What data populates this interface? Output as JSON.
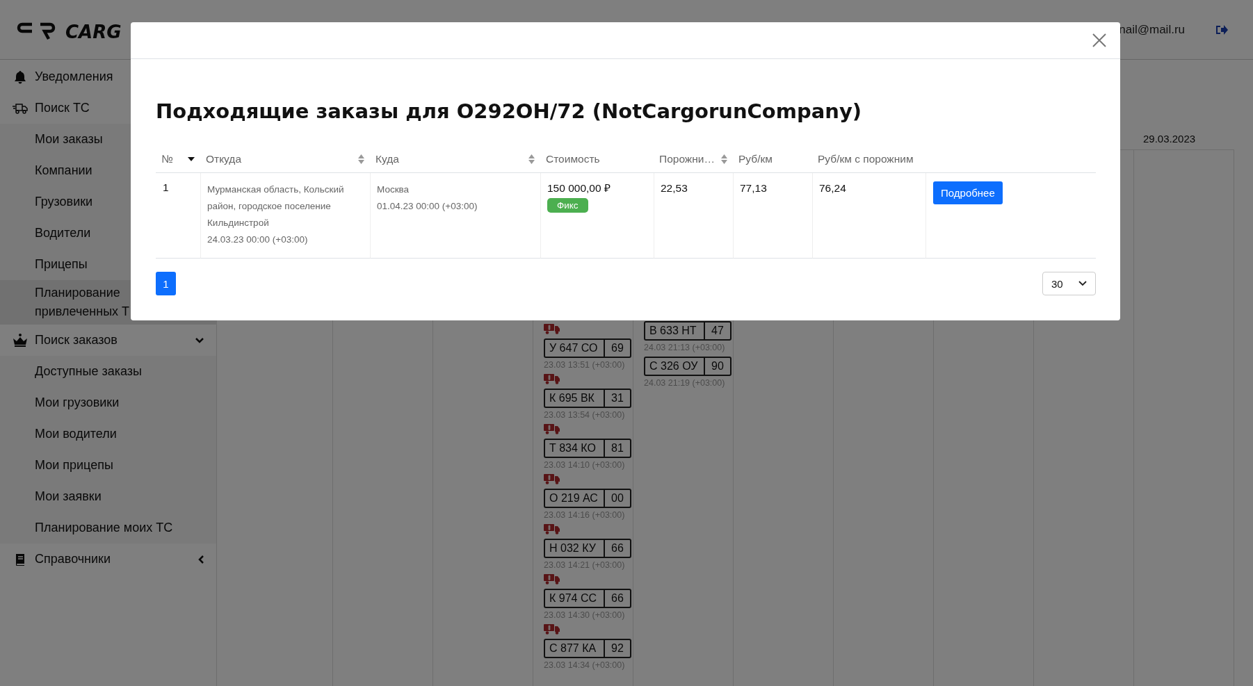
{
  "header": {
    "logo_text": "CARG",
    "user_email": "nail@mail.ru"
  },
  "sidebar": {
    "items": [
      {
        "label": "Уведомления",
        "selected": false
      },
      {
        "label": "Поиск ТС",
        "selected": false,
        "children": [
          {
            "label": "Мои заказы",
            "selected": false
          },
          {
            "label": "Компании",
            "selected": false
          },
          {
            "label": "Грузовики",
            "selected": false
          },
          {
            "label": "Водители",
            "selected": false
          },
          {
            "label": "Прицепы",
            "selected": false
          },
          {
            "label": "Планирование привлеченных Т",
            "selected": true
          }
        ]
      },
      {
        "label": "Поиск заказов",
        "selected": false,
        "expanded": true,
        "children": [
          {
            "label": "Доступные заказы",
            "selected": false
          },
          {
            "label": "Мои грузовики",
            "selected": false
          },
          {
            "label": "Мои водители",
            "selected": false
          },
          {
            "label": "Мои прицепы",
            "selected": false
          },
          {
            "label": "Мои заявки",
            "selected": false
          },
          {
            "label": "Планирование моих ТС",
            "selected": false
          }
        ]
      },
      {
        "label": "Справочники",
        "selected": false,
        "expanded": false
      }
    ]
  },
  "calendar": {
    "visible_date": "29.03.2023",
    "lanes": [
      {
        "entries": [
          {
            "kind": "truck",
            "plate": "У 647 СО",
            "region": "69",
            "time": "23.03 13:51 (+03:00)"
          },
          {
            "kind": "truck",
            "plate": "К 695 ВК",
            "region": "31",
            "time": "23.03 13:54 (+03:00)"
          },
          {
            "kind": "truck",
            "plate": "Т 834 КО",
            "region": "81",
            "time": "23.03 14:10 (+03:00)"
          },
          {
            "kind": "truck",
            "plate": "О 219 АС",
            "region": "00",
            "time": "23.03 14:16 (+03:00)"
          },
          {
            "kind": "truck",
            "plate": "Н 032 КУ",
            "region": "66",
            "time": "23.03 14:21 (+03:00)"
          },
          {
            "kind": "truck",
            "plate": "К 974 СС",
            "region": "66",
            "time": "23.03 14:30 (+03:00)"
          },
          {
            "kind": "truck",
            "plate": "С 877 КА",
            "region": "92",
            "time": "23.03 14:34 (+03:00)"
          }
        ]
      },
      {
        "entries": [
          {
            "kind": "plain",
            "plate": "В 633 НТ",
            "region": "47",
            "time": "24.03 21:13 (+03:00)"
          },
          {
            "kind": "plain",
            "plate": "С 326 ОУ",
            "region": "90",
            "time": "24.03 21:19 (+03:00)"
          }
        ]
      }
    ]
  },
  "modal": {
    "title": "Подходящие заказы для О292ОН/72 (NotCargorunCompany)",
    "columns": [
      {
        "label": "№",
        "sortable": true,
        "sorted": true
      },
      {
        "label": "Откуда",
        "sortable": true,
        "sorted": false
      },
      {
        "label": "Куда",
        "sortable": true,
        "sorted": false
      },
      {
        "label": "Стоимость",
        "sortable": false
      },
      {
        "label": "Порожни…",
        "sortable": true,
        "sorted": false
      },
      {
        "label": "Руб/км",
        "sortable": false
      },
      {
        "label": "Руб/км с порожним",
        "sortable": false
      }
    ],
    "rows": [
      {
        "number": "1",
        "from_address": "Мурманская область, Кольский район, городское поселение Кильдинстрой",
        "from_date": "24.03.23 00:00 (+03:00)",
        "to_city": "Москва",
        "to_date": "01.04.23 00:00 (+03:00)",
        "cost": "150 000,00 ₽",
        "tariff": "Фикс",
        "empty_run": "22,53",
        "rub_per_km": "77,13",
        "rub_per_km_with_empty": "76,24",
        "action": "Подробнее"
      }
    ],
    "pagination": {
      "pages": [
        {
          "label": "1",
          "selected": true
        }
      ],
      "page_size": "30"
    }
  }
}
